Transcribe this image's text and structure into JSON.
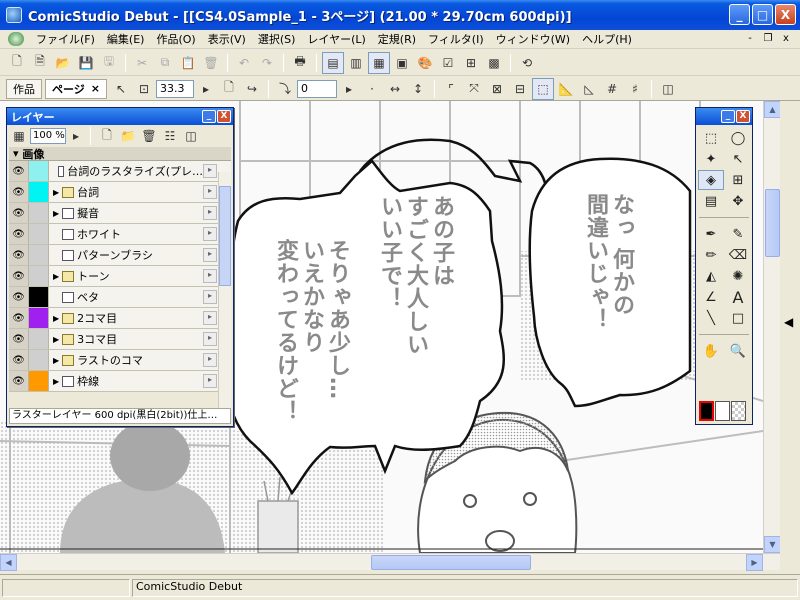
{
  "window": {
    "title": "ComicStudio Debut - [[CS4.0Sample_1 - 3ページ] (21.00 * 29.70cm 600dpi)]",
    "min": "_",
    "max": "□",
    "close": "X"
  },
  "menu": {
    "items": [
      "ファイル(F)",
      "編集(E)",
      "作品(O)",
      "表示(V)",
      "選択(S)",
      "レイヤー(L)",
      "定規(R)",
      "フィルタ(I)",
      "ウィンドウ(W)",
      "ヘルプ(H)"
    ],
    "mdi": [
      "-",
      "❐",
      "x"
    ]
  },
  "toolbar": {
    "tab_works": "作品",
    "tab_page": "ページ",
    "tab_close": "×",
    "zoom_value": "33.3",
    "rotate_value": "0"
  },
  "layer_panel": {
    "title": "レイヤー",
    "opacity": "100 %",
    "group_name": "画像",
    "layers": [
      {
        "name": "台詞のラスタライズ(プレ…",
        "color": "#8ff0f0",
        "type": "raster",
        "folder": false
      },
      {
        "name": "台詞",
        "color": "#00f4f4",
        "type": "folder",
        "folder": true
      },
      {
        "name": "擬音",
        "color": "#cfcfcf",
        "type": "raster",
        "folder": true
      },
      {
        "name": "ホワイト",
        "color": "#cfcfcf",
        "type": "raster",
        "folder": false
      },
      {
        "name": "パターンブラシ",
        "color": "#cfcfcf",
        "type": "raster",
        "folder": false
      },
      {
        "name": "トーン",
        "color": "#cfcfcf",
        "type": "folder",
        "folder": true
      },
      {
        "name": "ベタ",
        "color": "#000000",
        "type": "raster",
        "folder": false
      },
      {
        "name": "2コマ目",
        "color": "#a020f0",
        "type": "folder",
        "folder": true
      },
      {
        "name": "3コマ目",
        "color": "#cfcfcf",
        "type": "folder",
        "folder": true
      },
      {
        "name": "ラストのコマ",
        "color": "#cfcfcf",
        "type": "folder",
        "folder": true
      },
      {
        "name": "枠線",
        "color": "#ff9900",
        "type": "raster",
        "folder": true
      }
    ],
    "status": "ラスターレイヤー 600 dpi(黒白(2bit))仕上…"
  },
  "speech": {
    "left_bubble": [
      "そりゃあ少し…",
      "いえかなり",
      "変わってるけど！"
    ],
    "middle_bubble": [
      "あの子は",
      "すごく大人しい",
      "いい子で！"
    ],
    "right_bubble": [
      "なっ 何かの",
      "間違いじゃ！"
    ]
  },
  "statusbar": {
    "text": "ComicStudio Debut"
  },
  "colors": {
    "title_blue": "#0a4fd6",
    "chrome": "#ece9d8",
    "panel_border": "#0a246a"
  },
  "icons": {
    "eye": "👁",
    "folder": "folder-icon",
    "tools": [
      "marquee",
      "lasso",
      "magic-wand",
      "select-arrow",
      "layer-select",
      "grid",
      "hatch",
      "move",
      "pen",
      "pencil",
      "marker",
      "eraser",
      "fill",
      "airbrush",
      "ruler",
      "text",
      "line",
      "rectangle",
      "hand",
      "zoom"
    ]
  }
}
